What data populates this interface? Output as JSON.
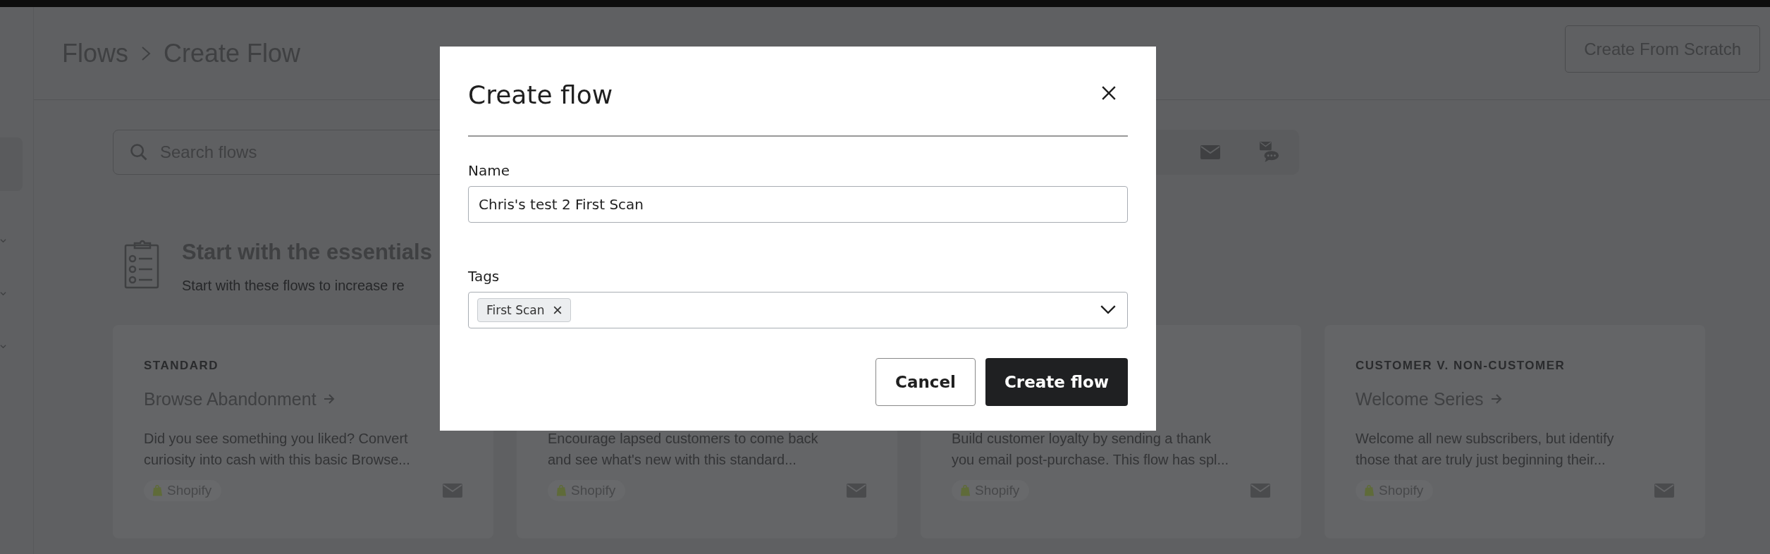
{
  "breadcrumb": [
    {
      "label": "Flows"
    },
    {
      "label": "Create Flow"
    }
  ],
  "header_button": "Create From Scratch",
  "search": {
    "placeholder": "Search flows"
  },
  "section": {
    "title": "Start with the essentials",
    "subtitle": "Start with these flows to increase re"
  },
  "cards": [
    {
      "label": "STANDARD",
      "title": "Browse Abandonment",
      "description_lines": [
        "Did you see something you liked? Convert",
        "curiosity into cash with this basic Browse..."
      ],
      "integration": "Shopify"
    },
    {
      "description_lines": [
        "Encourage lapsed customers to come back",
        "and see what's new with this standard..."
      ],
      "integration": "Shopify"
    },
    {
      "description_lines": [
        "Build customer loyalty by sending a thank",
        "you email post-purchase. This flow has spl..."
      ],
      "integration": "Shopify"
    },
    {
      "label": "CUSTOMER V. NON-CUSTOMER",
      "title": "Welcome Series",
      "description_lines": [
        "Welcome all new subscribers, but identify",
        "those that are truly just beginning their..."
      ],
      "integration": "Shopify"
    }
  ],
  "modal": {
    "title": "Create flow",
    "fields": [
      {
        "kind": "text",
        "label": "Name",
        "value": "Chris's test 2 First Scan"
      },
      {
        "kind": "tags",
        "label": "Tags",
        "tags": [
          "First Scan"
        ]
      }
    ],
    "buttons": [
      {
        "label": "Cancel",
        "kind": "secondary"
      },
      {
        "label": "Create flow",
        "kind": "primary"
      }
    ]
  }
}
